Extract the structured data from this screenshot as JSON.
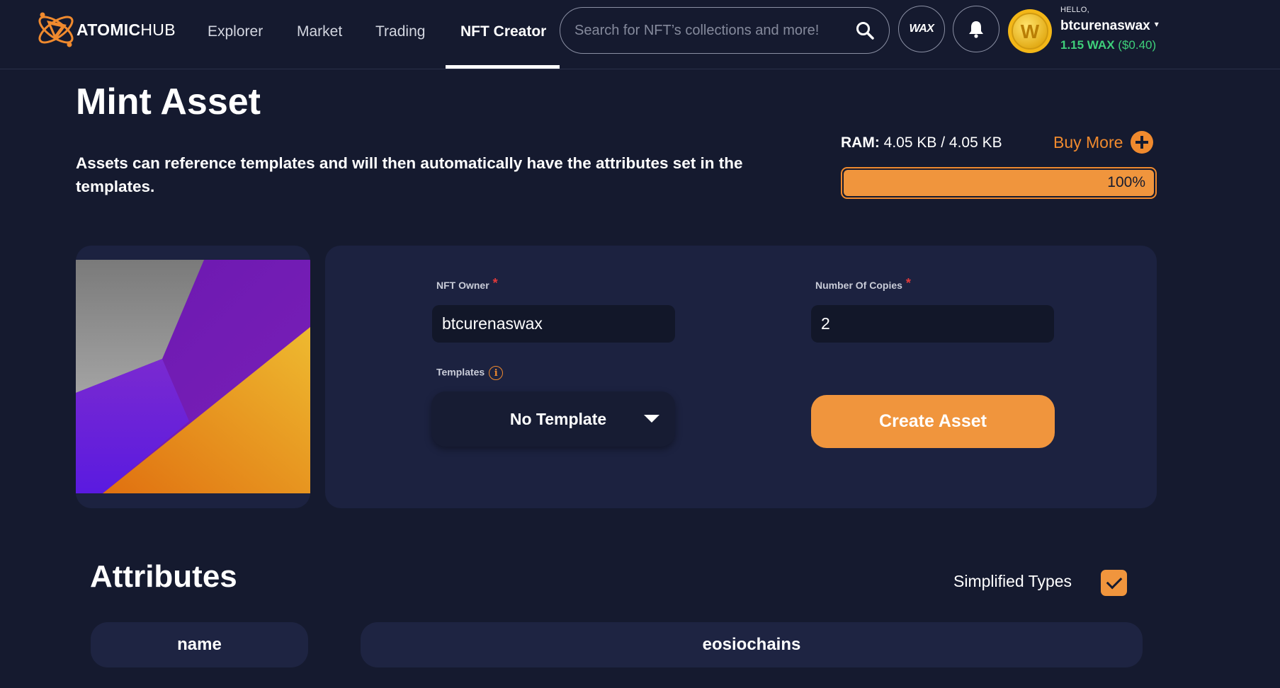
{
  "brand": {
    "name_bold": "ATOMIC",
    "name_light": "HUB",
    "accent": "#f08a2e"
  },
  "nav": {
    "links": [
      {
        "label": "Explorer",
        "active": false
      },
      {
        "label": "Market",
        "active": false
      },
      {
        "label": "Trading",
        "active": false
      },
      {
        "label": "NFT Creator",
        "active": true
      }
    ]
  },
  "search": {
    "placeholder": "Search for NFT’s collections and more!",
    "icon": "search-icon"
  },
  "header_actions": {
    "wax_label": "WAX",
    "bell_icon": "bell-icon"
  },
  "user": {
    "greeting": "HELLO,",
    "username": "btcurenaswax",
    "caret": "▾",
    "balance_wax": "1.15 WAX",
    "balance_usd": "($0.40)",
    "avatar_letter": "W"
  },
  "page": {
    "title": "Mint Asset",
    "description": "Assets can reference templates and will then automatically have the attributes set in the templates."
  },
  "ram": {
    "label": "RAM:",
    "value": "4.05 KB / 4.05 KB",
    "buy_more": "Buy More",
    "percent_text": "100%",
    "fill_fraction": 1.0
  },
  "form": {
    "owner_label": "NFT Owner",
    "owner_value": "btcurenaswax",
    "copies_label": "Number Of Copies",
    "copies_value": "2",
    "required_mark": "*",
    "templates_label": "Templates",
    "info_glyph": "i",
    "template_selected": "No Template",
    "create_button": "Create Asset"
  },
  "attributes": {
    "title": "Attributes",
    "simplified_label": "Simplified Types",
    "simplified_checked": true,
    "rows": [
      {
        "name": "name",
        "value": "eosiochains"
      }
    ]
  }
}
